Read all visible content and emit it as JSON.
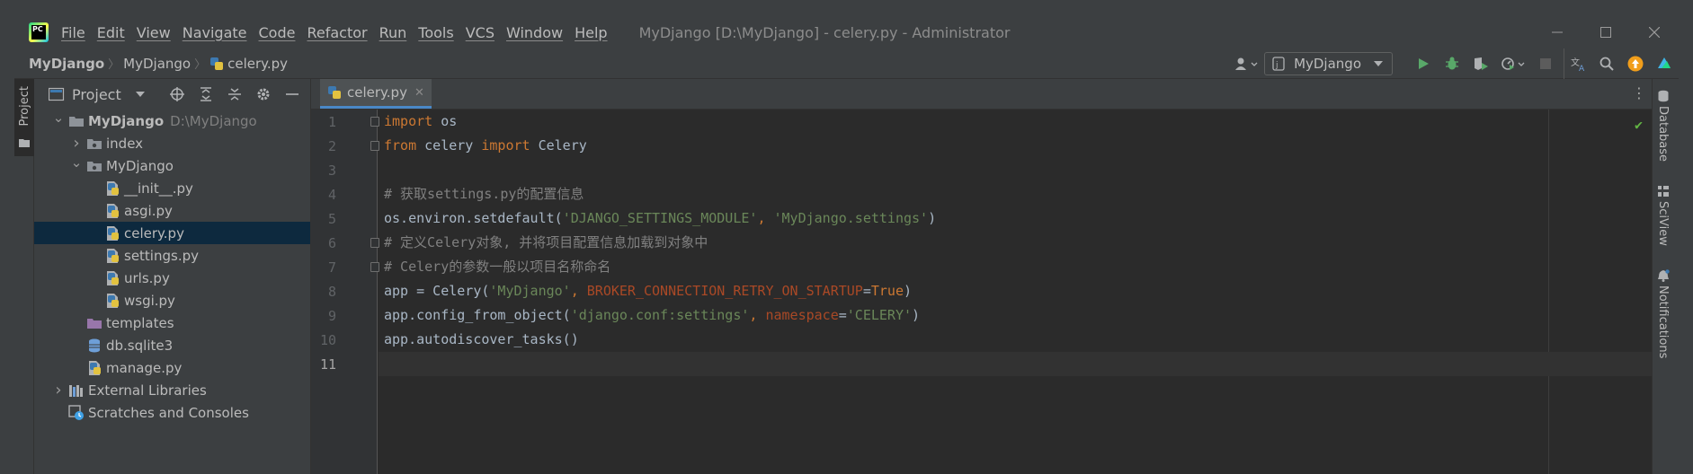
{
  "window": {
    "title": "MyDjango [D:\\MyDjango] - celery.py - Administrator",
    "logo_text": "PC"
  },
  "menu": [
    "File",
    "Edit",
    "View",
    "Navigate",
    "Code",
    "Refactor",
    "Run",
    "Tools",
    "VCS",
    "Window",
    "Help"
  ],
  "breadcrumbs": [
    "MyDjango",
    "MyDjango",
    "celery.py"
  ],
  "run_config": {
    "label": "MyDjango"
  },
  "project_panel": {
    "title": "Project",
    "tree": [
      {
        "label": "MyDjango",
        "hint": "D:\\MyDjango",
        "depth": 0,
        "arrow": "down",
        "icon": "folder-icon",
        "bold": true
      },
      {
        "label": "index",
        "depth": 1,
        "arrow": "right",
        "icon": "package-folder-icon"
      },
      {
        "label": "MyDjango",
        "depth": 1,
        "arrow": "down",
        "icon": "package-folder-icon"
      },
      {
        "label": "__init__.py",
        "depth": 2,
        "icon": "python-file-icon"
      },
      {
        "label": "asgi.py",
        "depth": 2,
        "icon": "python-file-icon"
      },
      {
        "label": "celery.py",
        "depth": 2,
        "icon": "python-file-icon",
        "selected": true
      },
      {
        "label": "settings.py",
        "depth": 2,
        "icon": "python-file-icon"
      },
      {
        "label": "urls.py",
        "depth": 2,
        "icon": "python-file-icon"
      },
      {
        "label": "wsgi.py",
        "depth": 2,
        "icon": "python-file-icon"
      },
      {
        "label": "templates",
        "depth": 1,
        "icon": "templates-folder-icon"
      },
      {
        "label": "db.sqlite3",
        "depth": 1,
        "icon": "database-icon"
      },
      {
        "label": "manage.py",
        "depth": 1,
        "icon": "python-file-icon"
      },
      {
        "label": "External Libraries",
        "depth": 0,
        "arrow": "right",
        "icon": "library-icon"
      },
      {
        "label": "Scratches and Consoles",
        "depth": 0,
        "icon": "scratch-icon"
      }
    ]
  },
  "editor": {
    "tab": "celery.py",
    "current_line": 11,
    "lines": [
      {
        "n": "1",
        "tokens": [
          {
            "t": "import",
            "c": "kw"
          },
          {
            "t": " os"
          }
        ]
      },
      {
        "n": "2",
        "tokens": [
          {
            "t": "from",
            "c": "kw"
          },
          {
            "t": " celery "
          },
          {
            "t": "import",
            "c": "kw"
          },
          {
            "t": " Celery"
          }
        ]
      },
      {
        "n": "3",
        "tokens": []
      },
      {
        "n": "4",
        "tokens": [
          {
            "t": "# 获取settings.py的配置信息",
            "c": "cm"
          }
        ]
      },
      {
        "n": "5",
        "tokens": [
          {
            "t": "os.environ.setdefault("
          },
          {
            "t": "'DJANGO_SETTINGS_MODULE'",
            "c": "str"
          },
          {
            "t": ", ",
            "c": "kw"
          },
          {
            "t": "'MyDjango.settings'",
            "c": "str"
          },
          {
            "t": ")"
          }
        ]
      },
      {
        "n": "6",
        "tokens": [
          {
            "t": "# 定义Celery对象, 并将项目配置信息加载到对象中",
            "c": "cm"
          }
        ]
      },
      {
        "n": "7",
        "tokens": [
          {
            "t": "# Celery的参数一般以项目名称命名",
            "c": "cm"
          }
        ]
      },
      {
        "n": "8",
        "tokens": [
          {
            "t": "app = Celery("
          },
          {
            "t": "'MyDjango'",
            "c": "str"
          },
          {
            "t": ", ",
            "c": "kw"
          },
          {
            "t": "BROKER_CONNECTION_RETRY_ON_STARTUP",
            "c": "param"
          },
          {
            "t": "="
          },
          {
            "t": "True",
            "c": "kw"
          },
          {
            "t": ")"
          }
        ]
      },
      {
        "n": "9",
        "tokens": [
          {
            "t": "app.config_from_object("
          },
          {
            "t": "'django.conf:settings'",
            "c": "str"
          },
          {
            "t": ", ",
            "c": "kw"
          },
          {
            "t": "namespace",
            "c": "param"
          },
          {
            "t": "="
          },
          {
            "t": "'CELERY'",
            "c": "str"
          },
          {
            "t": ")"
          }
        ]
      },
      {
        "n": "10",
        "tokens": [
          {
            "t": "app.autodiscover_tasks()"
          }
        ]
      },
      {
        "n": "11",
        "tokens": []
      }
    ]
  },
  "right_tools": [
    "Database",
    "SciView",
    "Notifications"
  ],
  "left_tools": [
    "Project"
  ],
  "colors": {
    "keyword": "#cc7832",
    "string": "#6a8759",
    "comment": "#808080",
    "parameter": "#aa4926",
    "run_green": "#59a869",
    "selection": "#0d293e",
    "accent": "#4a88c7"
  }
}
